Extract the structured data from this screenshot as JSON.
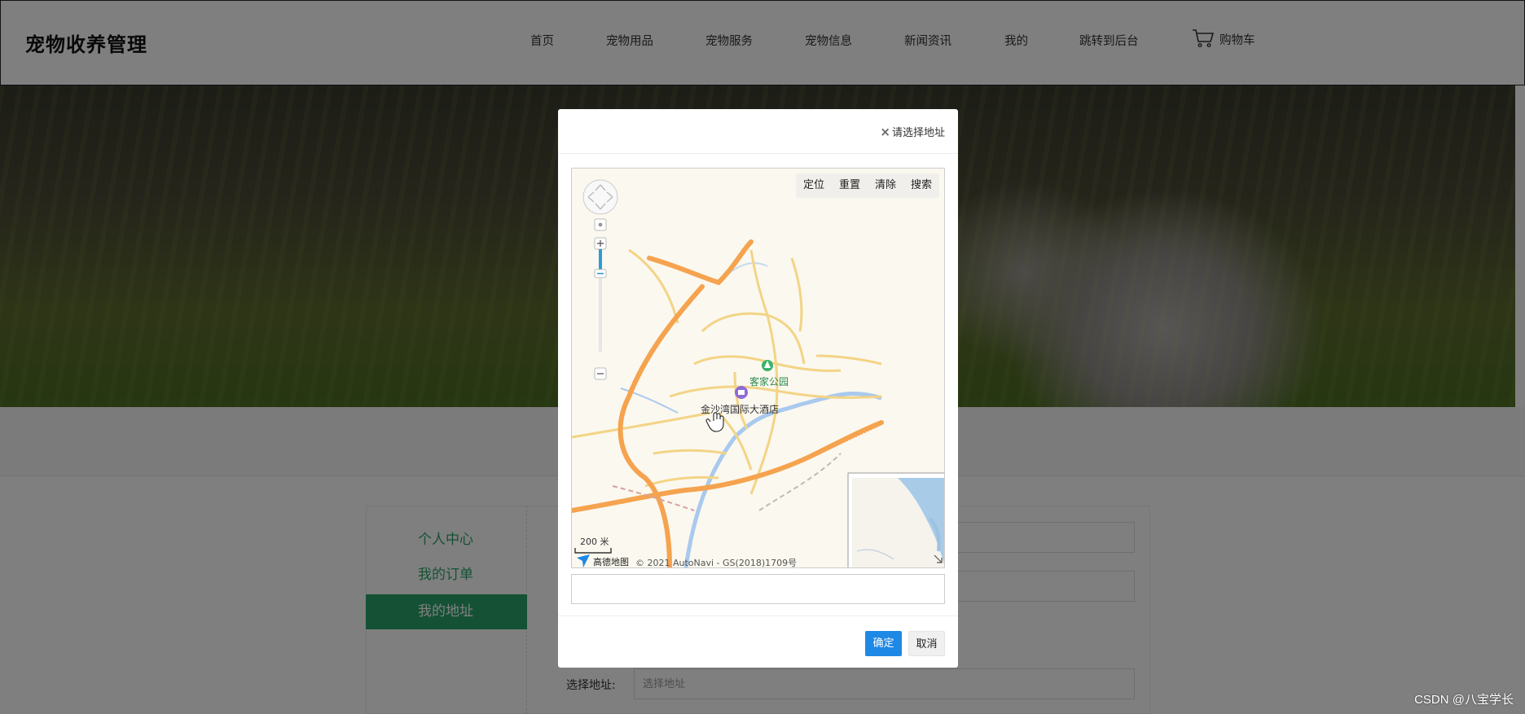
{
  "header": {
    "logo": "宠物收养管理",
    "nav": [
      "首页",
      "宠物用品",
      "宠物服务",
      "宠物信息",
      "新闻资讯",
      "我的",
      "跳转到后台"
    ],
    "cart_label": "购物车"
  },
  "sidebar": {
    "items": [
      {
        "label": "个人中心",
        "active": false
      },
      {
        "label": "我的订单",
        "active": false
      },
      {
        "label": "我的地址",
        "active": true
      }
    ]
  },
  "form": {
    "address_label": "选择地址:",
    "address_placeholder": "选择地址"
  },
  "dialog": {
    "title": "请选择地址",
    "toolbar": [
      "定位",
      "重置",
      "清除",
      "搜索"
    ],
    "map": {
      "poi_park": "客家公园",
      "poi_hotel": "金沙湾国际大酒店",
      "scale": "200 米",
      "brand": "高德地图",
      "copyright": "© 2021 AutoNavi - GS(2018)1709号"
    },
    "search_value": "",
    "ok_label": "确定",
    "cancel_label": "取消"
  },
  "watermark": "CSDN @八宝学长",
  "colors": {
    "accent_green": "#2aa56a",
    "primary_blue": "#1e88e5"
  }
}
